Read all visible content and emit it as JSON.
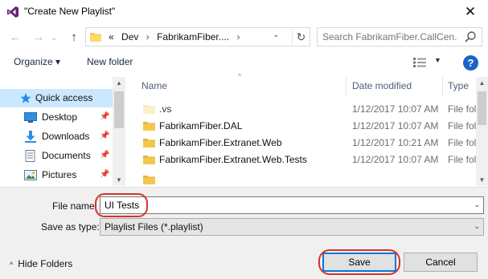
{
  "window": {
    "title": "\"Create New Playlist\"",
    "close_glyph": "✕",
    "app_icon": "visual-studio-icon"
  },
  "navigation": {
    "back_glyph": "←",
    "forward_glyph": "→",
    "recent_glyph": "⌄",
    "up_glyph": "↑",
    "address": {
      "overflow": "«",
      "crumbs": [
        "Dev",
        "FabrikamFiber...."
      ],
      "separator": "›",
      "dropdown_glyph": "⌄",
      "refresh_glyph": "↻"
    },
    "search": {
      "placeholder": "Search FabrikamFiber.CallCen..."
    }
  },
  "toolbar": {
    "organize_label": "Organize ▾",
    "new_folder_label": "New folder",
    "view_dropdown_glyph": "▼",
    "help_label": "?"
  },
  "nav_pane": {
    "items": [
      {
        "label": "Quick access",
        "icon": "star-icon",
        "pinned": false,
        "selected": true
      },
      {
        "label": "Desktop",
        "icon": "desktop-icon",
        "pinned": true,
        "selected": false
      },
      {
        "label": "Downloads",
        "icon": "download-icon",
        "pinned": true,
        "selected": false
      },
      {
        "label": "Documents",
        "icon": "documents-icon",
        "pinned": true,
        "selected": false
      },
      {
        "label": "Pictures",
        "icon": "pictures-icon",
        "pinned": true,
        "selected": false
      }
    ],
    "pin_glyph": "📌"
  },
  "file_list": {
    "columns": [
      "Name",
      "Date modified",
      "Type"
    ],
    "sort_glyph": "^",
    "rows": [
      {
        "name": ".vs",
        "date": "1/12/2017 10:07 AM",
        "type": "File folder",
        "hidden": true
      },
      {
        "name": "FabrikamFiber.DAL",
        "date": "1/12/2017 10:07 AM",
        "type": "File folder",
        "hidden": false
      },
      {
        "name": "FabrikamFiber.Extranet.Web",
        "date": "1/12/2017 10:21 AM",
        "type": "File folder",
        "hidden": false
      },
      {
        "name": "FabrikamFiber.Extranet.Web.Tests",
        "date": "1/12/2017 10:07 AM",
        "type": "File folder",
        "hidden": false
      }
    ]
  },
  "form": {
    "file_name_label": "File name:",
    "file_name_value": "UI Tests",
    "save_as_type_label": "Save as type:",
    "save_as_type_value": "Playlist Files (*.playlist)",
    "dropdown_glyph": "⌄"
  },
  "footer": {
    "hide_folders_caret": "^",
    "hide_folders_label": "Hide Folders",
    "save_label": "Save",
    "cancel_label": "Cancel"
  },
  "colors": {
    "selection": "#cce8ff",
    "folder": "#f3c84e",
    "accent": "#0078d7",
    "annotation": "#d9302a"
  }
}
